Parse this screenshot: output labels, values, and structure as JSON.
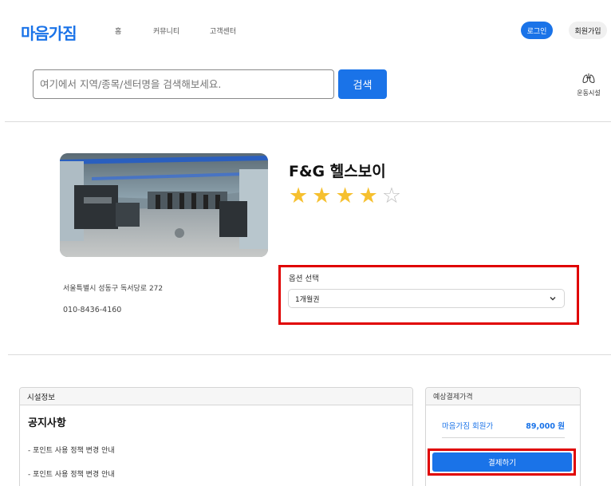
{
  "header": {
    "logo": "마음가짐",
    "nav": [
      "홈",
      "커뮤니티",
      "고객센터"
    ],
    "login_label": "로그인",
    "signup_label": "회원가입"
  },
  "search": {
    "placeholder": "여기에서 지역/종목/센터명을 검색해보세요.",
    "button_label": "검색"
  },
  "facility_shortcut": {
    "label": "운동시설",
    "icon": "lungs-icon"
  },
  "gym": {
    "name": "F&G 헬스보이",
    "rating": 4,
    "max_rating": 5,
    "address": "서울특별시 성동구 독서당로 272",
    "phone": "010-8436-4160"
  },
  "option": {
    "label": "옵션 선택",
    "selected": "1개월권"
  },
  "facility_info": {
    "header": "시설정보",
    "notice_title": "공지사항",
    "notices": [
      "- 포인트 사용 정책 변경 안내",
      "- 포인트 사용 정책 변경 안내"
    ]
  },
  "payment": {
    "header": "예상결제가격",
    "member_label": "마음가짐 회원가",
    "price": "89,000 원",
    "pay_button": "결제하기"
  },
  "colors": {
    "accent": "#1a73e8",
    "highlight": "#e00000",
    "star": "#f6c02f"
  }
}
